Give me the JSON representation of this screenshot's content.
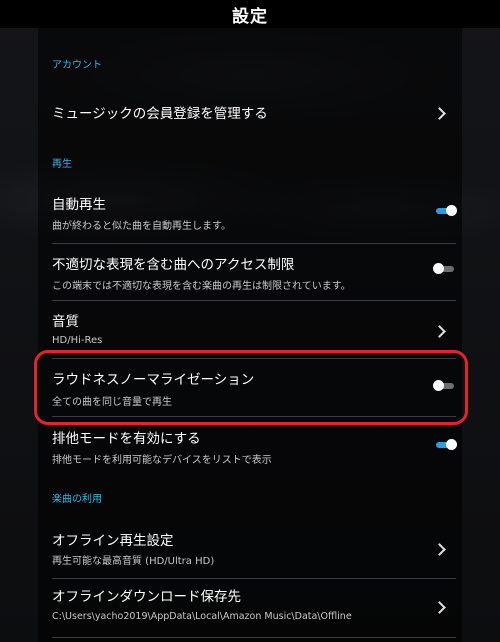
{
  "header": {
    "title": "設定"
  },
  "sections": {
    "account": "アカウント",
    "playback": "再生",
    "music_use": "楽曲の利用"
  },
  "rows": {
    "manage_membership": {
      "title": "ミュージックの会員登録を管理する"
    },
    "autoplay": {
      "title": "自動再生",
      "subtitle": "曲が終わると似た曲を自動再生します。",
      "toggle_on": true
    },
    "explicit": {
      "title": "不適切な表現を含む曲へのアクセス制限",
      "subtitle": "この端末では不適切な表現を含む楽曲の再生は制限されています。",
      "toggle_on": false
    },
    "quality": {
      "title": "音質",
      "subtitle": "HD/Hi-Res"
    },
    "loudness": {
      "title": "ラウドネスノーマライゼーション",
      "subtitle": "全ての曲を同じ音量で再生",
      "toggle_on": false
    },
    "exclusive": {
      "title": "排他モードを有効にする",
      "subtitle": "排他モードを利用可能なデバイスをリストで表示",
      "toggle_on": true
    },
    "offline_playback": {
      "title": "オフライン再生設定",
      "subtitle": "再生可能な最高音質 (HD/Ultra HD)"
    },
    "offline_download": {
      "title": "オフラインダウンロード保存先",
      "subtitle": "C:\\Users\\yacho2019\\AppData\\Local\\Amazon Music\\Data\\Offline"
    }
  },
  "colors": {
    "accent": "#2fb7e8",
    "toggle_on": "#2a9fe0",
    "highlight": "#e4232e"
  }
}
